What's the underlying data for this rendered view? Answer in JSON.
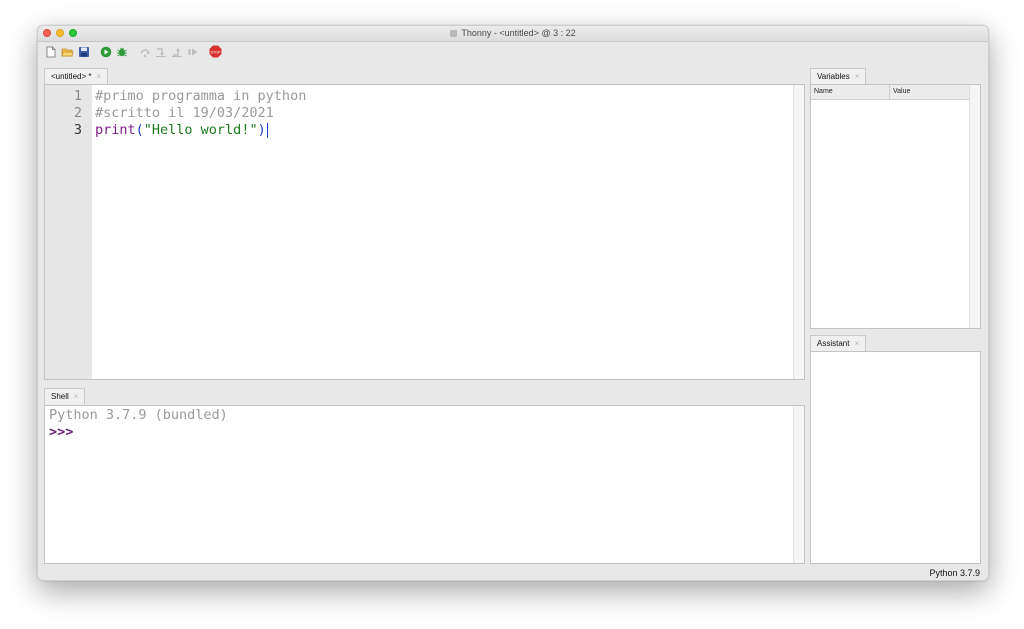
{
  "window": {
    "title": "Thonny  -  <untitled>  @  3 : 22"
  },
  "toolbar": {
    "buttons": [
      {
        "name": "new-file-icon",
        "color": "#ffffff"
      },
      {
        "name": "open-file-icon",
        "color": "#e8b339"
      },
      {
        "name": "save-icon",
        "color": "#3a5fa8"
      },
      {
        "name": "run-icon",
        "color": "#2e9b3a"
      },
      {
        "name": "debug-icon",
        "color": "#2e9b3a"
      },
      {
        "name": "step-over-icon",
        "color": "#bdbdbd"
      },
      {
        "name": "step-into-icon",
        "color": "#bdbdbd"
      },
      {
        "name": "step-out-icon",
        "color": "#bdbdbd"
      },
      {
        "name": "resume-icon",
        "color": "#bdbdbd"
      },
      {
        "name": "stop-icon",
        "color": "#d7322e"
      }
    ],
    "stop_label": "STOP"
  },
  "editor": {
    "tab_label": "<untitled> *",
    "tab_close": "×",
    "line_numbers": [
      "1",
      "2",
      "3"
    ],
    "lines": {
      "l1": "#primo programma in python",
      "l2": "#scritto il 19/03/2021",
      "l3_func": "print",
      "l3_open": "(",
      "l3_str": "\"Hello world!\"",
      "l3_close": ")"
    }
  },
  "shell": {
    "tab_label": "Shell",
    "tab_close": "×",
    "banner": "Python 3.7.9 (bundled)",
    "prompt": ">>>"
  },
  "variables": {
    "tab_label": "Variables",
    "tab_close": "×",
    "columns": [
      "Name",
      "Value"
    ]
  },
  "assistant": {
    "tab_label": "Assistant",
    "tab_close": "×"
  },
  "status": {
    "interpreter": "Python 3.7.9"
  }
}
